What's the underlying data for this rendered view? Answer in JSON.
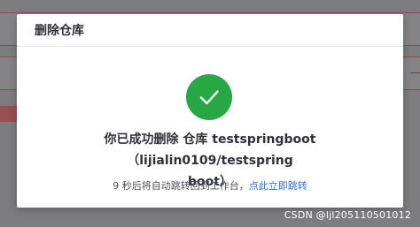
{
  "background": {
    "right_hint": "一",
    "right_hint_color": "#5a4a4a"
  },
  "modal": {
    "title": "删除仓库",
    "icon": "check-circle-icon",
    "icon_color": "#28a745",
    "message_line1": "你已成功删除 仓库 testspringboot（lijialin0109/testspring",
    "message_line2": "boot）",
    "redirect_text": "9 秒后将自动跳转回到工作台，",
    "redirect_link": "点此立即跳转",
    "link_color": "#2f6fd6"
  },
  "watermark": {
    "text": "CSDN @ljl205110501012"
  }
}
